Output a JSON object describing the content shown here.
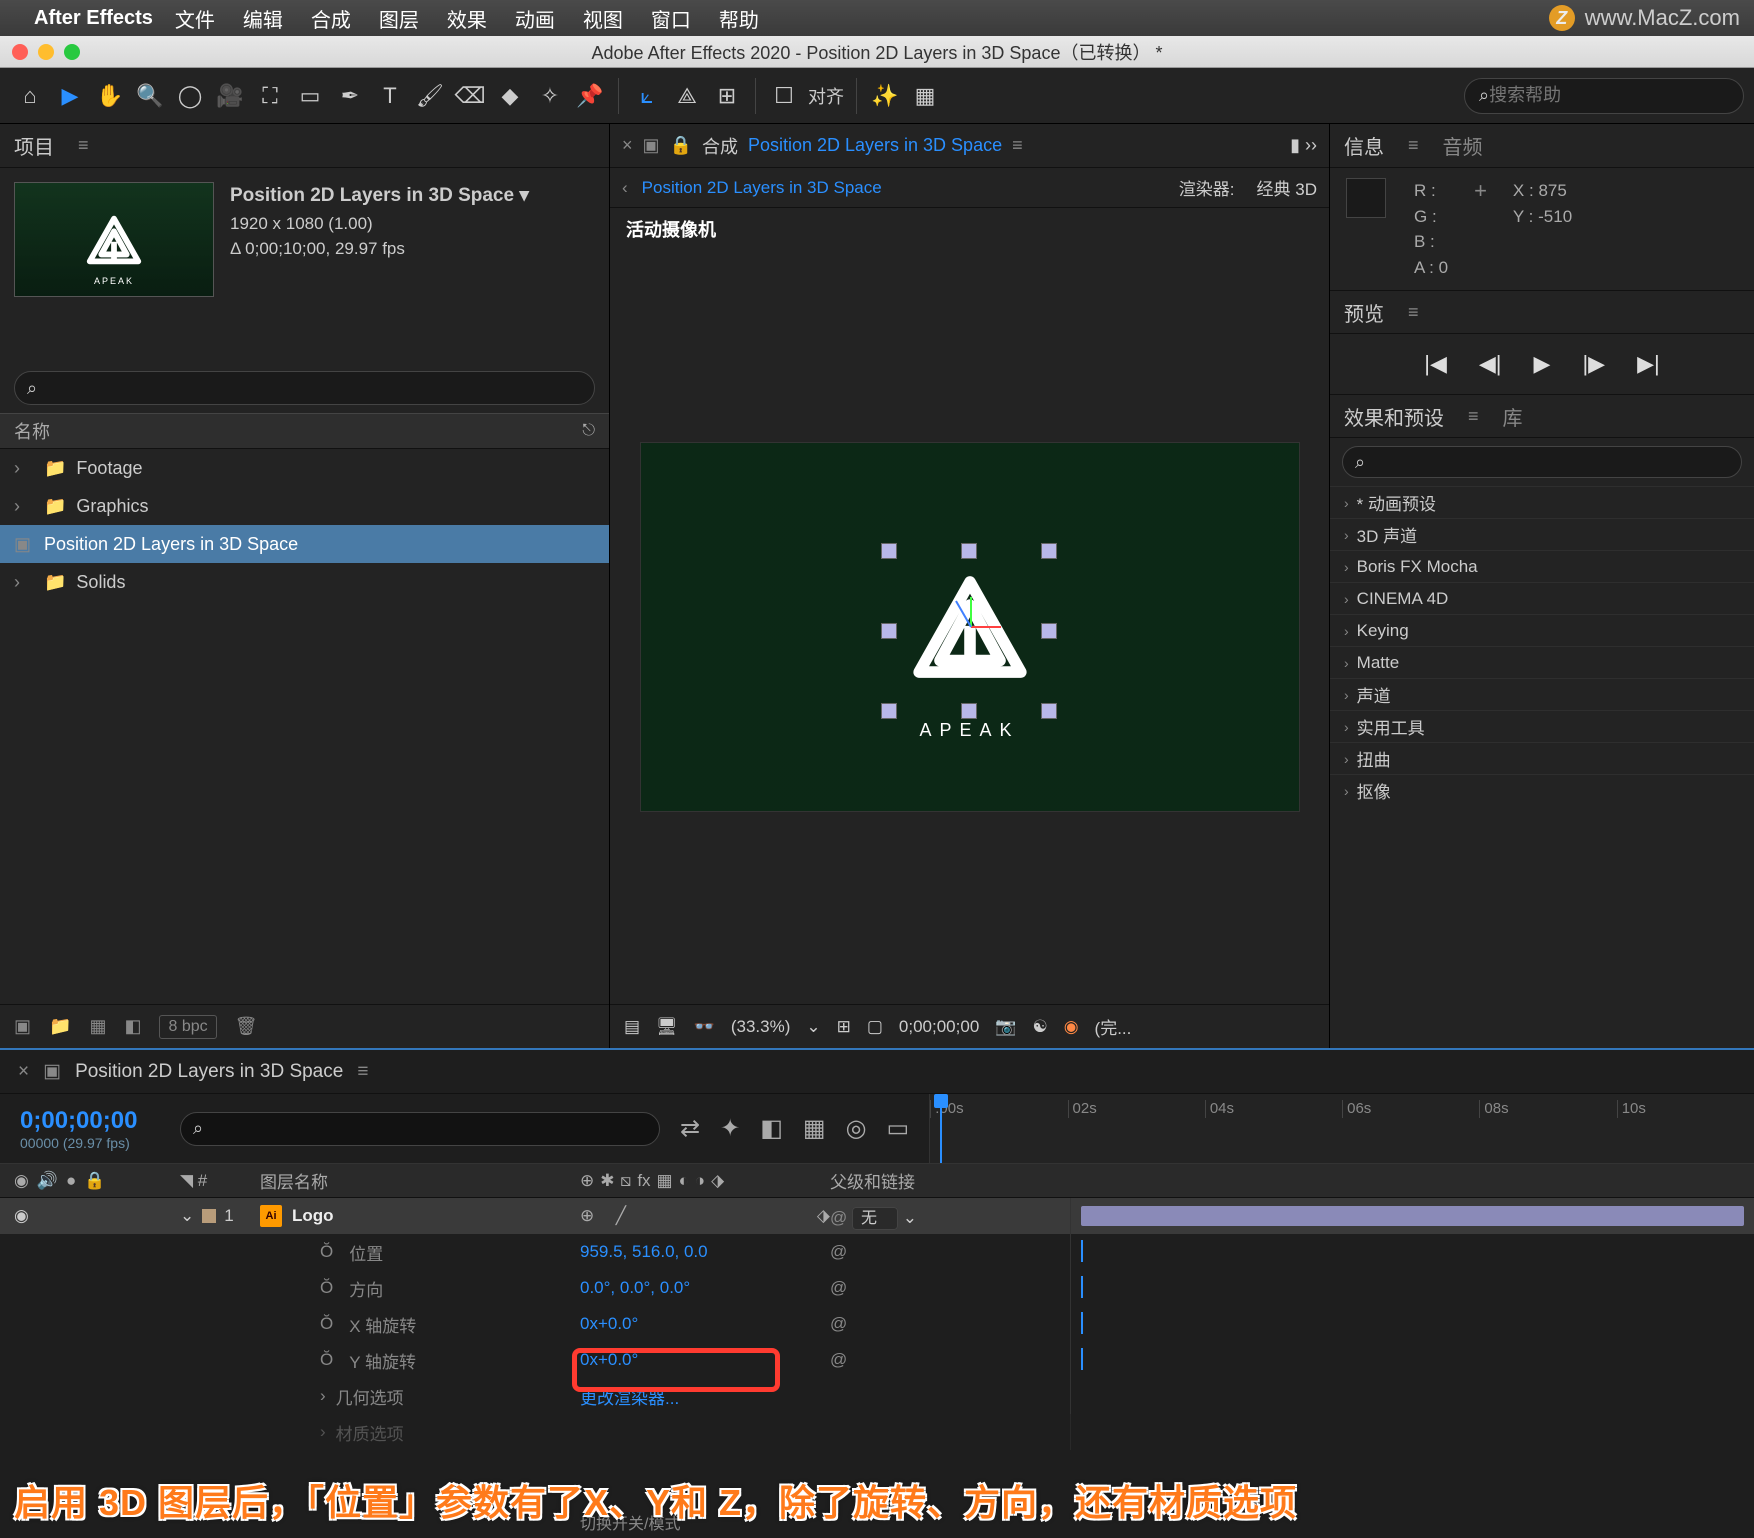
{
  "menubar": {
    "app": "After Effects",
    "items": [
      "文件",
      "编辑",
      "合成",
      "图层",
      "效果",
      "动画",
      "视图",
      "窗口",
      "帮助"
    ],
    "watermark": "www.MacZ.com"
  },
  "window": {
    "title": "Adobe After Effects 2020 - Position 2D Layers in 3D Space（已转换） *"
  },
  "toolbar": {
    "align": "对齐",
    "search_placeholder": "搜索帮助"
  },
  "project": {
    "tab": "项目",
    "item_title": "Position 2D Layers in 3D Space ▾",
    "dims": "1920 x 1080 (1.00)",
    "dur": "Δ 0;00;10;00, 29.97 fps",
    "tree_header": "名称",
    "items": [
      {
        "name": "Footage",
        "type": "folder"
      },
      {
        "name": "Graphics",
        "type": "folder"
      },
      {
        "name": "Position 2D Layers in 3D Space",
        "type": "comp",
        "selected": true
      },
      {
        "name": "Solids",
        "type": "folder"
      }
    ],
    "bpc": "8 bpc"
  },
  "comp": {
    "tab_prefix": "合成",
    "tab_name": "Position 2D Layers in 3D Space",
    "breadcrumb": "Position 2D Layers in 3D Space",
    "renderer_label": "渲染器:",
    "renderer_value": "经典 3D",
    "camera": "活动摄像机",
    "logo_text": "APEAK",
    "zoom": "(33.3%)",
    "timecode": "0;00;00;00",
    "full_label": "(完..."
  },
  "info": {
    "tab": "信息",
    "tab2": "音频",
    "r": "R :",
    "g": "G :",
    "b": "B :",
    "a": "A :",
    "a_val": "0",
    "x": "X :",
    "x_val": "875",
    "y": "Y :",
    "y_val": "-510"
  },
  "preview": {
    "tab": "预览"
  },
  "effects": {
    "tab": "效果和预设",
    "tab2": "库",
    "items": [
      "* 动画预设",
      "3D 声道",
      "Boris FX Mocha",
      "CINEMA 4D",
      "Keying",
      "Matte",
      "声道",
      "实用工具",
      "扭曲",
      "抠像"
    ]
  },
  "timeline": {
    "tab": "Position 2D Layers in 3D Space",
    "tc": "0;00;00;00",
    "fps": "00000 (29.97 fps)",
    "ruler": [
      ":00s",
      "02s",
      "04s",
      "06s",
      "08s",
      "10s"
    ],
    "col_layer": "图层名称",
    "col_parent": "父级和链接",
    "layer": {
      "index": "1",
      "name": "Logo",
      "parent": "无",
      "props": [
        {
          "name": "位置",
          "val": "959.5, 516.0, 0.0"
        },
        {
          "name": "方向",
          "val": "0.0°, 0.0°, 0.0°"
        },
        {
          "name": "X 轴旋转",
          "val": "0x+0.0°"
        },
        {
          "name": "Y 轴旋转",
          "val": "0x+0.0°"
        }
      ],
      "geo": "几何选项",
      "render_link": "更改渲染器...",
      "mat": "材质选项"
    },
    "toggle": "切换开关/模式"
  },
  "annotation": "启用 3D 图层后，「位置」参数有了X、Y和 Z，除了旋转、方向，还有材质选项"
}
